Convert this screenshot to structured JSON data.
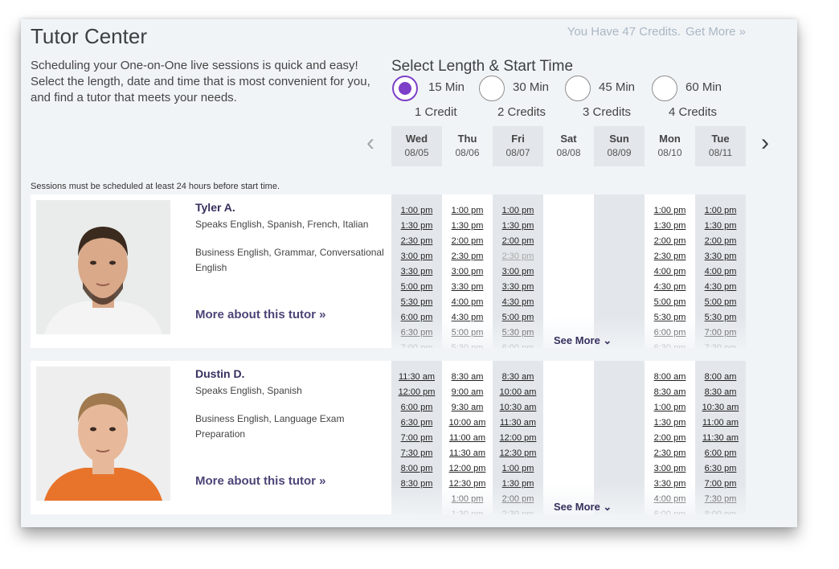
{
  "header": {
    "title": "Tutor Center",
    "credits_text": "You Have 47 Credits.",
    "get_more": "Get More »"
  },
  "intro": "Scheduling your One-on-One live sessions is quick and easy! Select the length, date and time that is most convenient for you, and find a tutor that meets your needs.",
  "length": {
    "title": "Select Length & Start Time",
    "options": [
      {
        "label": "15 Min",
        "credits": "1 Credit",
        "selected": true
      },
      {
        "label": "30 Min",
        "credits": "2 Credits",
        "selected": false
      },
      {
        "label": "45 Min",
        "credits": "3 Credits",
        "selected": false
      },
      {
        "label": "60 Min",
        "credits": "4 Credits",
        "selected": false
      }
    ]
  },
  "days": [
    {
      "name": "Wed",
      "date": "08/05"
    },
    {
      "name": "Thu",
      "date": "08/06"
    },
    {
      "name": "Fri",
      "date": "08/07"
    },
    {
      "name": "Sat",
      "date": "08/08"
    },
    {
      "name": "Sun",
      "date": "08/09"
    },
    {
      "name": "Mon",
      "date": "08/10"
    },
    {
      "name": "Tue",
      "date": "08/11"
    }
  ],
  "notice": "Sessions must be scheduled at least 24 hours before start time.",
  "see_more": "See More ⌄",
  "colors": {
    "accent": "#7d3fc8",
    "tutor_name": "#36305e",
    "link": "#4c4577"
  },
  "tutors": [
    {
      "name": "Tyler A.",
      "languages": "Speaks English, Spanish, French, Italian",
      "specialties": "Business English, Grammar, Conversational English",
      "more": "More about this tutor »",
      "slots": [
        [
          "1:00 pm",
          "1:30 pm",
          "2:30 pm",
          "3:00 pm",
          "3:30 pm",
          "5:00 pm",
          "5:30 pm",
          "6:00 pm",
          "6:30 pm",
          "7:00 pm"
        ],
        [
          "1:00 pm",
          "1:30 pm",
          "2:00 pm",
          "2:30 pm",
          "3:00 pm",
          "3:30 pm",
          "4:00 pm",
          "4:30 pm",
          "5:00 pm",
          "5:30 pm"
        ],
        [
          "1:00 pm",
          "1:30 pm",
          "2:00 pm",
          "2:30 pm",
          "3:00 pm",
          "3:30 pm",
          "4:30 pm",
          "5:00 pm",
          "5:30 pm",
          "6:00 pm"
        ],
        [],
        [],
        [
          "1:00 pm",
          "1:30 pm",
          "2:00 pm",
          "2:30 pm",
          "4:00 pm",
          "4:30 pm",
          "5:00 pm",
          "5:30 pm",
          "6:00 pm",
          "6:30 pm"
        ],
        [
          "1:00 pm",
          "1:30 pm",
          "2:00 pm",
          "3:30 pm",
          "4:00 pm",
          "4:30 pm",
          "5:00 pm",
          "5:30 pm",
          "7:00 pm",
          "7:30 pm"
        ]
      ],
      "faded": [
        [],
        [],
        [
          3
        ],
        [],
        [],
        [],
        []
      ]
    },
    {
      "name": "Dustin D.",
      "languages": "Speaks English, Spanish",
      "specialties": "Business English, Language Exam Preparation",
      "more": "More about this tutor »",
      "slots": [
        [
          "11:30 am",
          "12:00 pm",
          "6:00 pm",
          "6:30 pm",
          "7:00 pm",
          "7:30 pm",
          "8:00 pm",
          "8:30 pm"
        ],
        [
          "8:30 am",
          "9:00 am",
          "9:30 am",
          "10:00 am",
          "11:00 am",
          "11:30 am",
          "12:00 pm",
          "12:30 pm",
          "1:00 pm",
          "1:30 pm"
        ],
        [
          "8:30 am",
          "10:00 am",
          "10:30 am",
          "11:30 am",
          "12:00 pm",
          "12:30 pm",
          "1:00 pm",
          "1:30 pm",
          "2:00 pm",
          "2:30 pm"
        ],
        [],
        [],
        [
          "8:00 am",
          "8:30 am",
          "1:00 pm",
          "1:30 pm",
          "2:00 pm",
          "2:30 pm",
          "3:00 pm",
          "3:30 pm",
          "4:00 pm",
          "6:00 pm"
        ],
        [
          "8:00 am",
          "8:30 am",
          "10:30 am",
          "11:00 am",
          "11:30 am",
          "6:00 pm",
          "6:30 pm",
          "7:00 pm",
          "7:30 pm",
          "8:00 pm"
        ]
      ],
      "faded": [
        [],
        [],
        [],
        [],
        [],
        [],
        []
      ]
    }
  ]
}
